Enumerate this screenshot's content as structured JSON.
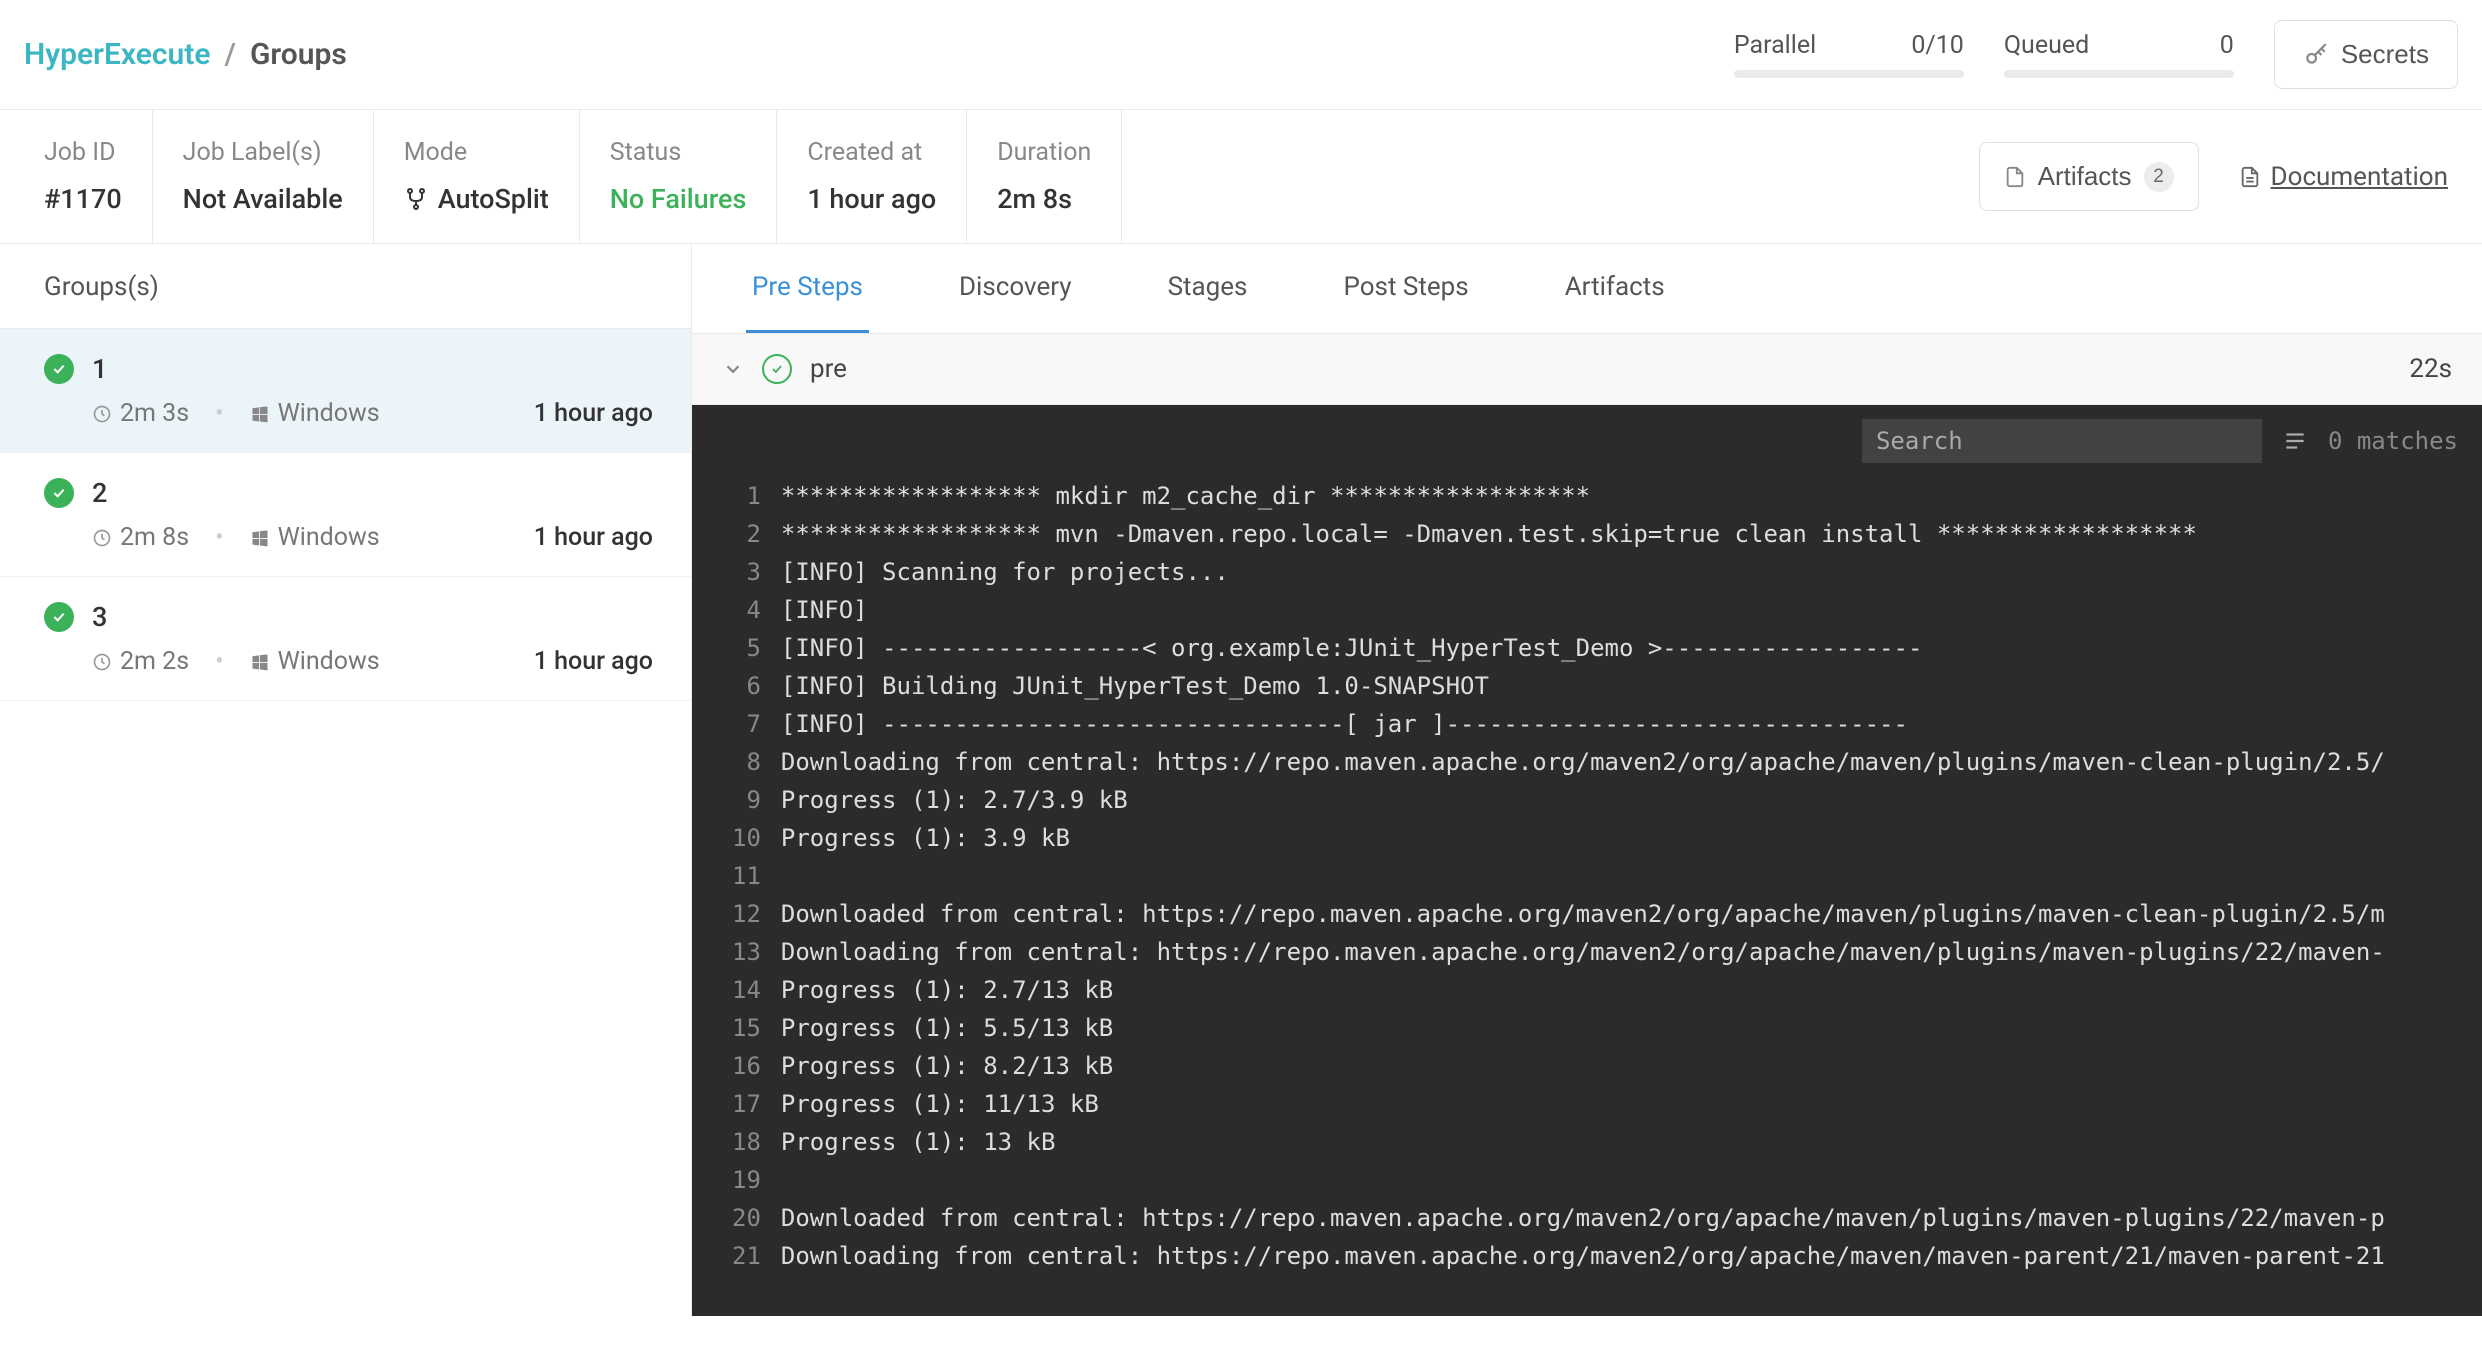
{
  "breadcrumb": {
    "brand": "HyperExecute",
    "sep": "/",
    "current": "Groups"
  },
  "metrics": {
    "parallel": {
      "label": "Parallel",
      "value": "0/10"
    },
    "queued": {
      "label": "Queued",
      "value": "0"
    }
  },
  "secrets_btn": "Secrets",
  "info": {
    "job_id": {
      "label": "Job ID",
      "value": "#1170"
    },
    "labels": {
      "label": "Job Label(s)",
      "value": "Not Available"
    },
    "mode": {
      "label": "Mode",
      "value": "AutoSplit"
    },
    "status": {
      "label": "Status",
      "value": "No Failures"
    },
    "created": {
      "label": "Created at",
      "value": "1 hour ago"
    },
    "duration": {
      "label": "Duration",
      "value": "2m 8s"
    }
  },
  "artifacts_btn": {
    "label": "Artifacts",
    "badge": "2"
  },
  "doc_link": "Documentation",
  "sidebar": {
    "header": "Groups(s)",
    "items": [
      {
        "idx": "1",
        "duration": "2m 3s",
        "os": "Windows",
        "age": "1 hour ago"
      },
      {
        "idx": "2",
        "duration": "2m 8s",
        "os": "Windows",
        "age": "1 hour ago"
      },
      {
        "idx": "3",
        "duration": "2m 2s",
        "os": "Windows",
        "age": "1 hour ago"
      }
    ]
  },
  "tabs": [
    "Pre Steps",
    "Discovery",
    "Stages",
    "Post Steps",
    "Artifacts"
  ],
  "step": {
    "name": "pre",
    "duration": "22s"
  },
  "console": {
    "search_placeholder": "Search",
    "matches": "0 matches",
    "lines": [
      "****************** mkdir m2_cache_dir ******************",
      "****************** mvn -Dmaven.repo.local= -Dmaven.test.skip=true clean install ******************",
      "[INFO] Scanning for projects...",
      "[INFO]",
      "[INFO] ------------------< org.example:JUnit_HyperTest_Demo >------------------",
      "[INFO] Building JUnit_HyperTest_Demo 1.0-SNAPSHOT",
      "[INFO] --------------------------------[ jar ]--------------------------------",
      "Downloading from central: https://repo.maven.apache.org/maven2/org/apache/maven/plugins/maven-clean-plugin/2.5/",
      "Progress (1): 2.7/3.9 kB",
      "Progress (1): 3.9 kB",
      "",
      "Downloaded from central: https://repo.maven.apache.org/maven2/org/apache/maven/plugins/maven-clean-plugin/2.5/m",
      "Downloading from central: https://repo.maven.apache.org/maven2/org/apache/maven/plugins/maven-plugins/22/maven-",
      "Progress (1): 2.7/13 kB",
      "Progress (1): 5.5/13 kB",
      "Progress (1): 8.2/13 kB",
      "Progress (1): 11/13 kB",
      "Progress (1): 13 kB",
      "",
      "Downloaded from central: https://repo.maven.apache.org/maven2/org/apache/maven/plugins/maven-plugins/22/maven-p",
      "Downloading from central: https://repo.maven.apache.org/maven2/org/apache/maven/maven-parent/21/maven-parent-21"
    ]
  }
}
